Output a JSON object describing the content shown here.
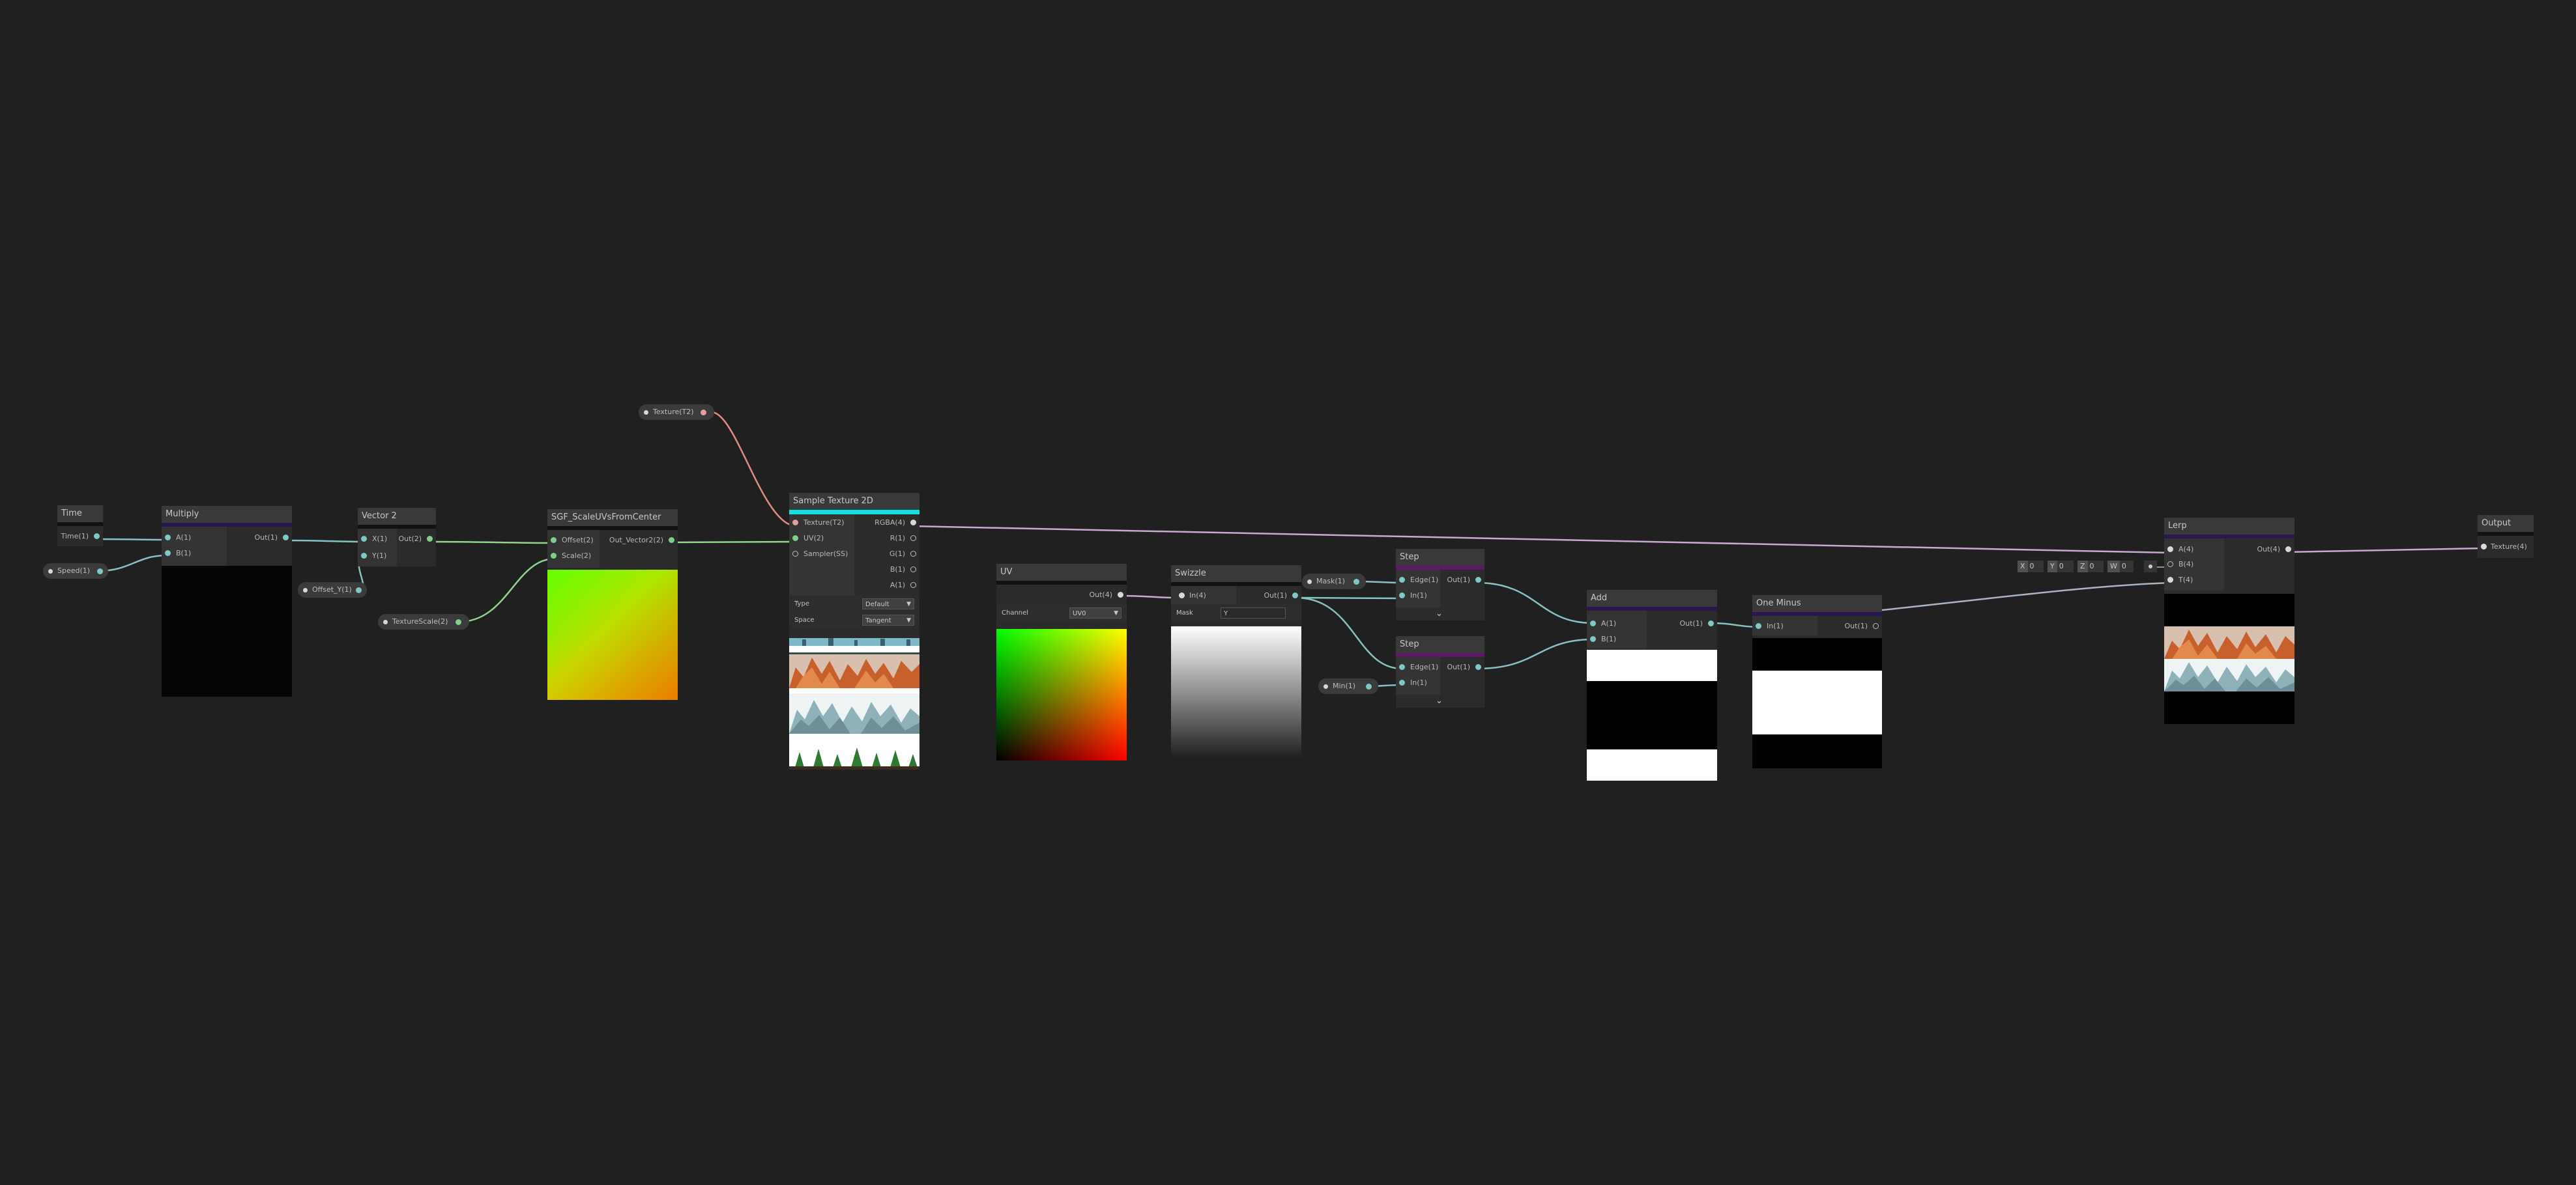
{
  "nodes": {
    "time": {
      "title": "Time",
      "out": "Time(1)"
    },
    "speed": {
      "label": "Speed(1)"
    },
    "multiply": {
      "title": "Multiply",
      "in_a": "A(1)",
      "in_b": "B(1)",
      "out": "Out(1)"
    },
    "vector2": {
      "title": "Vector 2",
      "in_x": "X(1)",
      "in_y": "Y(1)",
      "out": "Out(2)"
    },
    "offset": {
      "label": "Offset_Y(1)"
    },
    "texture_scale": {
      "label": "TextureScale(2)"
    },
    "sgf": {
      "title": "SGF_ScaleUVsFromCenter",
      "in_offset": "Offset(2)",
      "in_scale": "Scale(2)",
      "out": "Out_Vector2(2)"
    },
    "texture_prop": {
      "label": "Texture(T2)"
    },
    "sample": {
      "title": "Sample Texture 2D",
      "in_texture": "Texture(T2)",
      "in_uv": "UV(2)",
      "in_sampler": "Sampler(SS)",
      "out_rgba": "RGBA(4)",
      "out_r": "R(1)",
      "out_g": "G(1)",
      "out_b": "B(1)",
      "out_a": "A(1)",
      "type_label": "Type",
      "type_value": "Default",
      "space_label": "Space",
      "space_value": "Tangent"
    },
    "uv": {
      "title": "UV",
      "out": "Out(4)",
      "channel_label": "Channel",
      "channel_value": "UV0"
    },
    "swizzle": {
      "title": "Swizzle",
      "in": "In(4)",
      "out": "Out(1)",
      "mask_label": "Mask",
      "mask_value": "Y"
    },
    "mask": {
      "label": "Mask(1)"
    },
    "min": {
      "label": "Min(1)"
    },
    "step1": {
      "title": "Step",
      "in_edge": "Edge(1)",
      "in_in": "In(1)",
      "out": "Out(1)"
    },
    "step2": {
      "title": "Step",
      "in_edge": "Edge(1)",
      "in_in": "In(1)",
      "out": "Out(1)"
    },
    "add": {
      "title": "Add",
      "in_a": "A(1)",
      "in_b": "B(1)",
      "out": "Out(1)"
    },
    "one_minus": {
      "title": "One Minus",
      "in": "In(1)",
      "out": "Out(1)"
    },
    "lerp": {
      "title": "Lerp",
      "in_a": "A(4)",
      "in_b": "B(4)",
      "in_t": "T(4)",
      "out": "Out(4)"
    },
    "output": {
      "title": "Output",
      "in": "Texture(4)"
    }
  },
  "lerp_b_vector": {
    "x_label": "X",
    "x_value": "0",
    "y_label": "Y",
    "y_value": "0",
    "z_label": "Z",
    "z_value": "0",
    "w_label": "W",
    "w_value": "0"
  },
  "colors": {
    "background": "#202020",
    "node_body": "#2b2b2b",
    "node_header": "#393939",
    "wire_vector1": "#86c2c1",
    "wire_vector2": "#92d48f",
    "wire_vector4": "#c9a9cf",
    "wire_texture": "#e58c82",
    "accent_cyan": "#12e0e4",
    "accent_purple": "#2a1750",
    "accent_magenta": "#5e1868"
  }
}
